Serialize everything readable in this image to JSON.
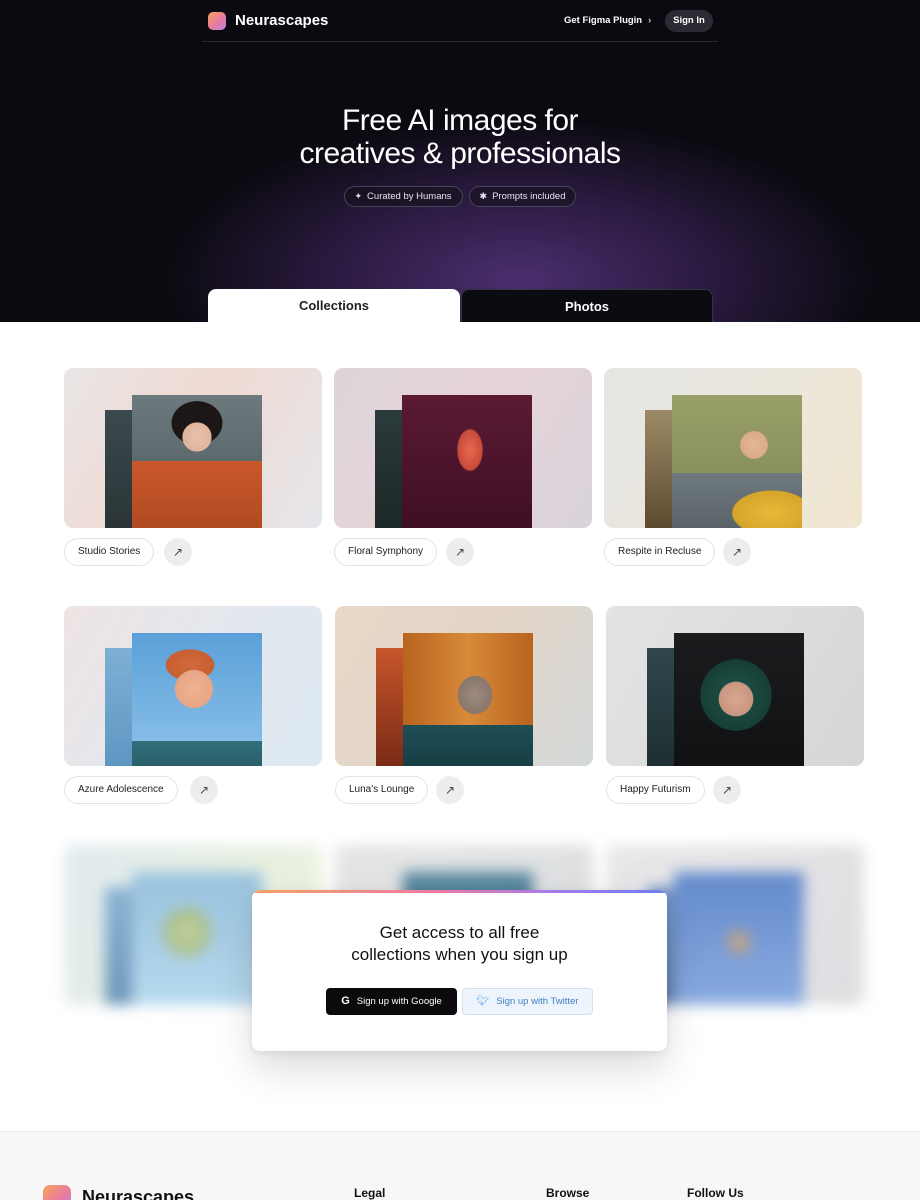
{
  "header": {
    "brand": "Neurascapes",
    "plugin_link": "Get Figma Plugin",
    "signin": "Sign In"
  },
  "hero": {
    "headline_line1": "Free AI images for",
    "headline_line2": "creatives & professionals",
    "chips": [
      {
        "icon": "sparkle-icon",
        "label": "Curated by Humans"
      },
      {
        "icon": "asterisk-icon",
        "label": "Prompts included"
      }
    ]
  },
  "tabs": [
    {
      "label": "Collections",
      "active": true
    },
    {
      "label": "Photos",
      "active": false
    }
  ],
  "collections": [
    {
      "name": "Studio Stories"
    },
    {
      "name": "Floral Symphony"
    },
    {
      "name": "Respite in Recluse"
    },
    {
      "name": "Azure Adolescence"
    },
    {
      "name": "Luna's Lounge"
    },
    {
      "name": "Happy Futurism"
    }
  ],
  "signup_modal": {
    "title_line1": "Get access to all free",
    "title_line2": "collections when you sign up",
    "google_button": "Sign up with Google",
    "twitter_button": "Sign up with Twitter"
  },
  "footer": {
    "brand": "Neurascapes",
    "columns": [
      "Legal",
      "Browse",
      "Follow Us"
    ]
  },
  "colors": {
    "hero_bg": "#0b0a10",
    "hero_glow": "#4a2f6e",
    "accent_gradient": [
      "#f4a261",
      "#ee7aa4",
      "#a07af0"
    ],
    "twitter_blue": "#3b9bf2"
  }
}
